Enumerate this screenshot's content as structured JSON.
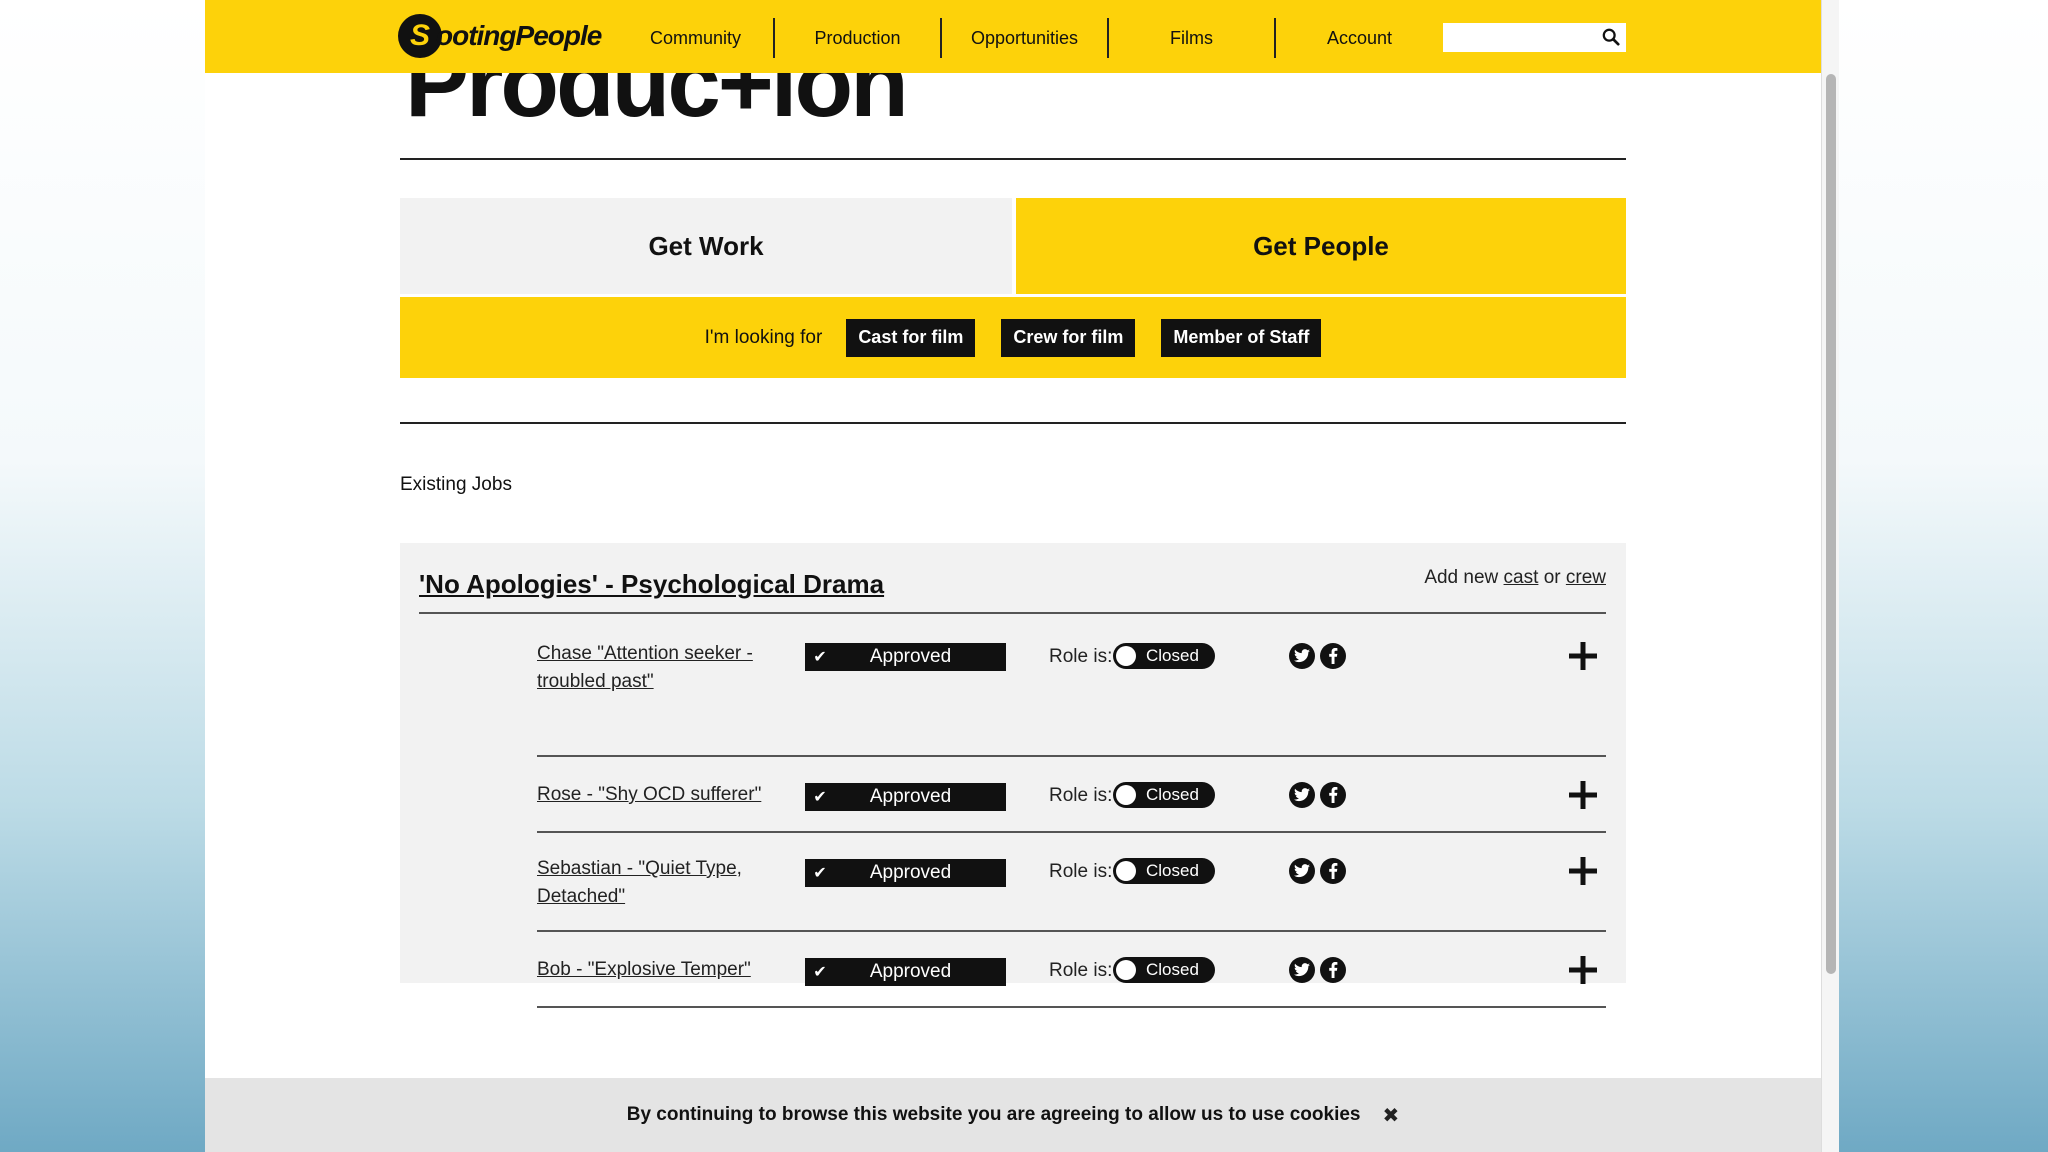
{
  "header": {
    "logo_badge": "S",
    "logo_text": "ootingPeople",
    "nav": [
      "Community",
      "Production",
      "Opportunities",
      "Films",
      "Account"
    ],
    "search_placeholder": ""
  },
  "hero": {
    "title": "Produc+ion"
  },
  "tabs": {
    "work": "Get Work",
    "people": "Get People"
  },
  "looking_for": {
    "label": "I'm looking for",
    "options": [
      "Cast for film",
      "Crew for film",
      "Member of Staff"
    ]
  },
  "existing_jobs_label": "Existing Jobs",
  "project": {
    "title": "'No Apologies' - Psychological Drama",
    "add_new_prefix": "Add new",
    "add_cast": "cast",
    "add_or": "or",
    "add_crew": "crew"
  },
  "jobs": [
    {
      "title": "Chase \"Attention seeker - troubled past\"",
      "status": "Approved",
      "role_label": "Role is:",
      "role_state": "Closed"
    },
    {
      "title": "Rose - \"Shy OCD sufferer\"",
      "status": "Approved",
      "role_label": "Role is:",
      "role_state": "Closed"
    },
    {
      "title": "Sebastian - \"Quiet Type, Detached\"",
      "status": "Approved",
      "role_label": "Role is:",
      "role_state": "Closed"
    },
    {
      "title": "Bob - \"Explosive Temper\"",
      "status": "Approved",
      "role_label": "Role is:",
      "role_state": "Closed"
    }
  ],
  "icons": {
    "check": "check-icon",
    "twitter": "twitter-icon",
    "facebook": "facebook-icon",
    "plus": "plus-icon",
    "search": "search-icon",
    "close": "close-icon"
  },
  "colors": {
    "brand_yellow": "#fdd20a",
    "dark": "#111111",
    "panel": "#f2f2f2"
  },
  "cookie": {
    "text": "By continuing to browse this website you are agreeing to allow us to use cookies",
    "close": "✖"
  }
}
